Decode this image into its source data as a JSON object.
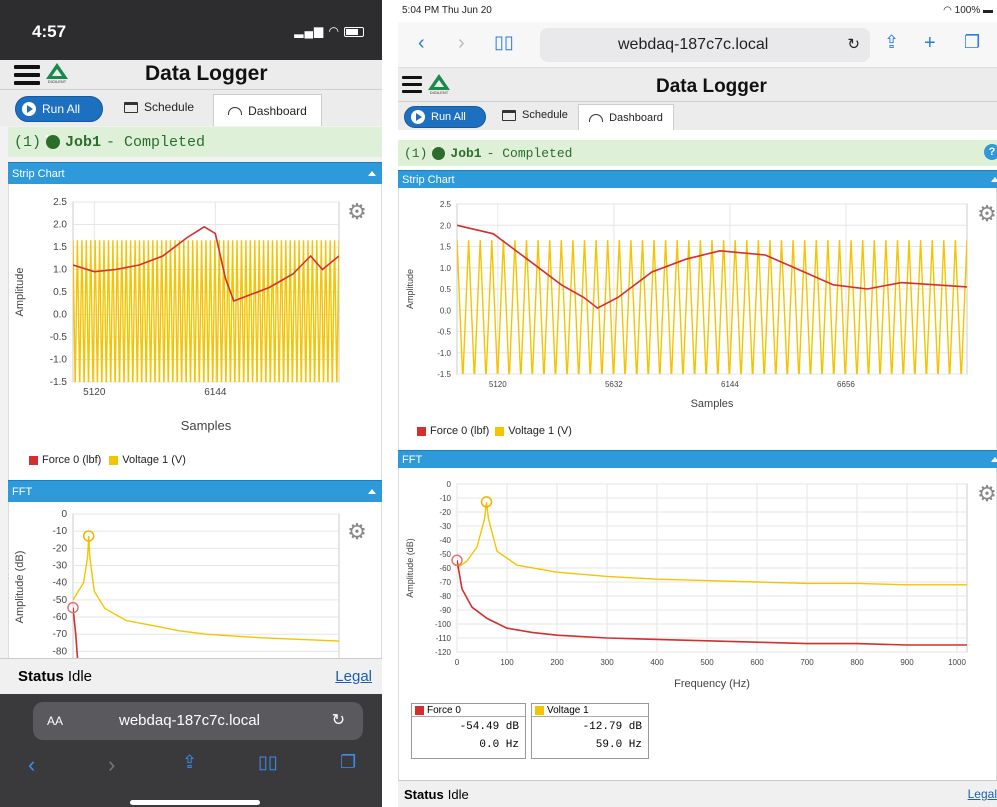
{
  "app": {
    "title": "Data Logger",
    "logo_text": "DIGILENT",
    "run_all_label": "Run All",
    "schedule_label": "Schedule",
    "dashboard_label": "Dashboard",
    "job_index": "(1)",
    "job_name": "Job1",
    "job_status": "- Completed",
    "strip_chart_label": "Strip Chart",
    "fft_label": "FFT",
    "status_label": "Status",
    "status_value": "Idle",
    "legal_label": "Legal",
    "help_label": "?"
  },
  "phone": {
    "time": "4:57",
    "url": "webdaq-187c7c.local",
    "text_size_label": "AA"
  },
  "tablet": {
    "time_date": "5:04 PM  Thu Jun 20",
    "battery": "100%",
    "url": "webdaq-187c7c.local"
  },
  "colors": {
    "force": "#d32f2f",
    "voltage": "#f5c400",
    "section": "#2f9ad9",
    "completed_bg": "#dff0d8"
  },
  "strip_legend": {
    "force": "Force 0 (lbf)",
    "voltage": "Voltage 1 (V)"
  },
  "fft_cards": [
    {
      "name": "Force 0",
      "db": "-54.49 dB",
      "hz": "0.0 Hz"
    },
    {
      "name": "Voltage 1",
      "db": "-12.79 dB",
      "hz": "59.0 Hz"
    }
  ],
  "chart_data": [
    {
      "id": "phone_strip",
      "type": "line",
      "xlabel": "Samples",
      "ylabel": "Amplitude",
      "ylim": [
        -1.5,
        2.5
      ],
      "yticks": [
        "2.5",
        "2.0",
        "1.5",
        "1.0",
        "0.5",
        "0.0",
        "-0.5",
        "-1.0",
        "-1.5"
      ],
      "xticks": [
        {
          "v": 5120,
          "label": "5120"
        },
        {
          "v": 6144,
          "label": "6144"
        }
      ],
      "xlim": [
        4940,
        7190
      ],
      "series": [
        {
          "name": "Force 0 (lbf)",
          "points": [
            [
              4940,
              1.1
            ],
            [
              5120,
              0.95
            ],
            [
              5300,
              1.0
            ],
            [
              5500,
              1.1
            ],
            [
              5700,
              1.3
            ],
            [
              5900,
              1.7
            ],
            [
              6050,
              1.95
            ],
            [
              6144,
              1.8
            ],
            [
              6230,
              0.8
            ],
            [
              6300,
              0.3
            ],
            [
              6450,
              0.45
            ],
            [
              6600,
              0.6
            ],
            [
              6800,
              0.9
            ],
            [
              6950,
              1.3
            ],
            [
              7050,
              1.0
            ],
            [
              7190,
              1.3
            ]
          ]
        },
        {
          "name": "Voltage 1 (V)",
          "amplitude": 1.65,
          "offset": 0.0,
          "cycles": 60
        }
      ]
    },
    {
      "id": "phone_fft",
      "type": "line",
      "ylabel": "Amplitude (dB)",
      "ylim": [
        -85,
        0
      ],
      "yticks": [
        "0",
        "-10",
        "-20",
        "-30",
        "-40",
        "-50",
        "-60",
        "-70",
        "-80"
      ],
      "xlim": [
        0,
        1000
      ],
      "series": [
        {
          "name": "Force 0",
          "points": [
            [
              0,
              -54.5
            ],
            [
              10,
              -70
            ],
            [
              20,
              -90
            ]
          ]
        },
        {
          "name": "Voltage 1",
          "points": [
            [
              0,
              -50
            ],
            [
              20,
              -45
            ],
            [
              40,
              -40
            ],
            [
              55,
              -25
            ],
            [
              59,
              -12.8
            ],
            [
              63,
              -25
            ],
            [
              80,
              -45
            ],
            [
              120,
              -55
            ],
            [
              200,
              -62
            ],
            [
              300,
              -65
            ],
            [
              400,
              -68
            ],
            [
              500,
              -70
            ],
            [
              700,
              -72
            ],
            [
              1000,
              -74
            ]
          ]
        }
      ]
    },
    {
      "id": "tablet_strip",
      "type": "line",
      "xlabel": "Samples",
      "ylabel": "Amplitude",
      "ylim": [
        -1.5,
        2.5
      ],
      "yticks": [
        "2.5",
        "2.0",
        "1.5",
        "1.0",
        "0.5",
        "0.0",
        "-0.5",
        "-1.0",
        "-1.5"
      ],
      "xticks": [
        {
          "v": 5120,
          "label": "5120"
        },
        {
          "v": 5632,
          "label": "5632"
        },
        {
          "v": 6144,
          "label": "6144"
        },
        {
          "v": 6656,
          "label": "6656"
        }
      ],
      "xlim": [
        4940,
        7190
      ],
      "series": [
        {
          "name": "Force 0 (lbf)",
          "points": [
            [
              4940,
              2.0
            ],
            [
              5100,
              1.8
            ],
            [
              5250,
              1.2
            ],
            [
              5400,
              0.6
            ],
            [
              5500,
              0.3
            ],
            [
              5560,
              0.05
            ],
            [
              5650,
              0.3
            ],
            [
              5800,
              0.9
            ],
            [
              5950,
              1.2
            ],
            [
              6100,
              1.4
            ],
            [
              6300,
              1.3
            ],
            [
              6450,
              0.95
            ],
            [
              6600,
              0.6
            ],
            [
              6750,
              0.5
            ],
            [
              6900,
              0.65
            ],
            [
              7050,
              0.6
            ],
            [
              7190,
              0.55
            ]
          ]
        },
        {
          "name": "Voltage 1 (V)",
          "amplitude": 1.65,
          "offset": 0.0,
          "cycles": 44
        }
      ]
    },
    {
      "id": "tablet_fft",
      "type": "line",
      "xlabel": "Frequency (Hz)",
      "ylabel": "Amplitude (dB)",
      "ylim": [
        -120,
        0
      ],
      "yticks": [
        "0",
        "-10",
        "-20",
        "-30",
        "-40",
        "-50",
        "-60",
        "-70",
        "-80",
        "-90",
        "-100",
        "-110",
        "-120"
      ],
      "xticks": [
        {
          "v": 0,
          "label": "0"
        },
        {
          "v": 100,
          "label": "100"
        },
        {
          "v": 200,
          "label": "200"
        },
        {
          "v": 300,
          "label": "300"
        },
        {
          "v": 400,
          "label": "400"
        },
        {
          "v": 500,
          "label": "500"
        },
        {
          "v": 600,
          "label": "600"
        },
        {
          "v": 700,
          "label": "700"
        },
        {
          "v": 800,
          "label": "800"
        },
        {
          "v": 900,
          "label": "900"
        },
        {
          "v": 1000,
          "label": "1000"
        }
      ],
      "xlim": [
        0,
        1020
      ],
      "series": [
        {
          "name": "Force 0",
          "points": [
            [
              0,
              -54.5
            ],
            [
              10,
              -75
            ],
            [
              30,
              -88
            ],
            [
              60,
              -96
            ],
            [
              100,
              -103
            ],
            [
              150,
              -106
            ],
            [
              200,
              -108
            ],
            [
              300,
              -110
            ],
            [
              400,
              -111
            ],
            [
              500,
              -112
            ],
            [
              600,
              -113
            ],
            [
              700,
              -114
            ],
            [
              800,
              -114
            ],
            [
              900,
              -115
            ],
            [
              1020,
              -115
            ]
          ]
        },
        {
          "name": "Voltage 1",
          "points": [
            [
              0,
              -60
            ],
            [
              20,
              -55
            ],
            [
              40,
              -45
            ],
            [
              55,
              -25
            ],
            [
              59,
              -12.8
            ],
            [
              63,
              -25
            ],
            [
              80,
              -48
            ],
            [
              120,
              -58
            ],
            [
              200,
              -63
            ],
            [
              300,
              -66
            ],
            [
              400,
              -68
            ],
            [
              500,
              -69
            ],
            [
              600,
              -70
            ],
            [
              700,
              -71
            ],
            [
              800,
              -71
            ],
            [
              900,
              -72
            ],
            [
              1020,
              -72
            ]
          ]
        }
      ]
    }
  ]
}
